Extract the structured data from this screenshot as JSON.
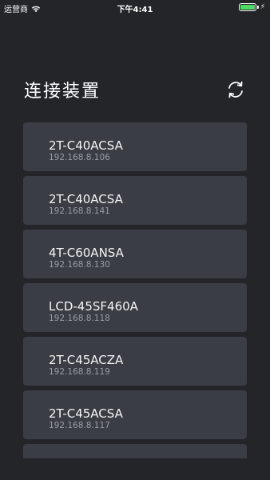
{
  "status_bar": {
    "carrier": "运营商",
    "time": "下午4:41",
    "battery_level": 1.0
  },
  "header": {
    "title": "连接装置",
    "refresh_icon": "refresh-icon"
  },
  "devices": [
    {
      "name": "2T-C40ACSA",
      "ip": "192.168.8.106"
    },
    {
      "name": "2T-C40ACSA",
      "ip": "192.168.8.141"
    },
    {
      "name": "4T-C60ANSA",
      "ip": "192.168.8.130"
    },
    {
      "name": "LCD-45SF460A",
      "ip": "192.168.8.118"
    },
    {
      "name": "2T-C45ACZA",
      "ip": "192.168.8.119"
    },
    {
      "name": "2T-C45ACSA",
      "ip": "192.168.8.117"
    }
  ],
  "colors": {
    "background": "#232529",
    "card": "#3a3d44",
    "ip_text": "#9a9da3",
    "battery": "#4cd964"
  }
}
